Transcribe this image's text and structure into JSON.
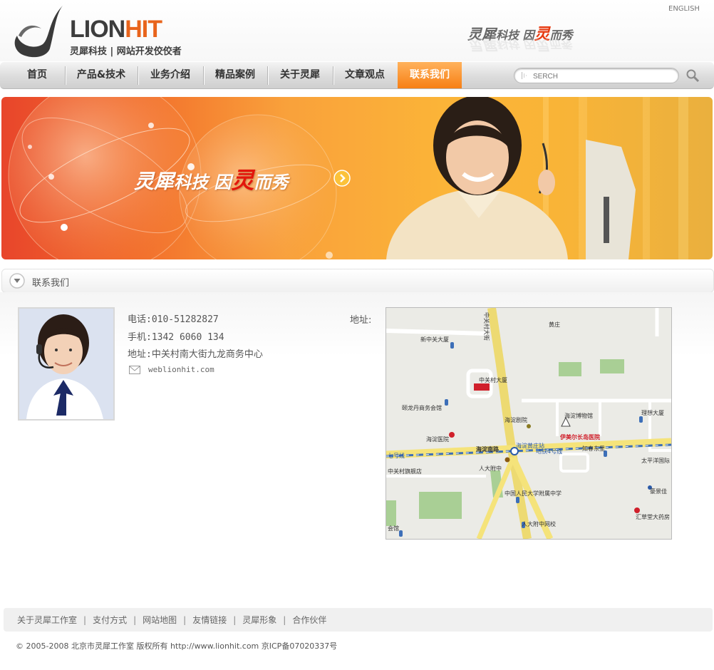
{
  "header": {
    "logo_lion": "LION",
    "logo_hit": "HIT",
    "logo_tagline": "灵犀科技 | 网站开发佼佼者",
    "lang_link": "ENGLISH",
    "slogan_a": "灵犀",
    "slogan_b": "科技  因",
    "slogan_c": "灵",
    "slogan_d": "而秀"
  },
  "nav": {
    "items": [
      {
        "label": "首页"
      },
      {
        "label": "产品&技术"
      },
      {
        "label": "业务介绍"
      },
      {
        "label": "精品案例"
      },
      {
        "label": "关于灵犀"
      },
      {
        "label": "文章观点"
      },
      {
        "label": "联系我们"
      }
    ],
    "active_index": 6,
    "search_placeholder": "SERCH"
  },
  "banner": {
    "slogan_a": "灵犀",
    "slogan_b": "科技  因",
    "slogan_c": "灵",
    "slogan_d": "而秀"
  },
  "section": {
    "title": "联系我们"
  },
  "contact": {
    "phone": "电话:010-51282827",
    "mobile": "手机:1342 6060 134",
    "address": "地址:中关村南大街九龙商务中心",
    "email": "weblionhit.com",
    "address_label": "地址:"
  },
  "map": {
    "labels": {
      "zhongguancun_st": "中关村大街",
      "huangzhuang": "黄庄",
      "xinzhongguan": "新中关大厦",
      "zgc_building": "中关村大厦",
      "yilongdan": "颐龙丹商务会馆",
      "haidian_theater": "海淀剧院",
      "haidian_museum": "海淀博物馆",
      "lixiang": "理想大厦",
      "iml_hospital": "伊美尔长岛医院",
      "haidian_hospital": "海淀医院",
      "haidian_south": "海淀南路",
      "hdhz_station": "海淀黄庄站",
      "line4": "地铁4号线",
      "line10a": "七号线",
      "line10b": "地铁十号线",
      "zhichun": "知春东里",
      "taipingyang": "太平洋国际",
      "rdfz": "人大附中",
      "zgc_store": "中关村旗舰店",
      "renda_middle": "中国人民大学附属中学",
      "renda_net": "人大附中网校",
      "yijingjia": "豪景佳",
      "huicaotang": "汇草堂大药房",
      "huiguan": "会馆"
    }
  },
  "footer": {
    "links": [
      "关于灵犀工作室",
      "支付方式",
      "网站地图",
      "友情链接",
      "灵犀形象",
      "合作伙伴"
    ],
    "copyright": "© 2005-2008 北京市灵犀工作室 版权所有 http://www.lionhit.com 京ICP备07020337号"
  },
  "colors": {
    "accent_orange": "#f7841a",
    "logo_orange": "#e8641c",
    "slogan_red": "#e3160b",
    "map_road_yellow": "#f5e37a",
    "map_park_green": "#a9cf95"
  }
}
